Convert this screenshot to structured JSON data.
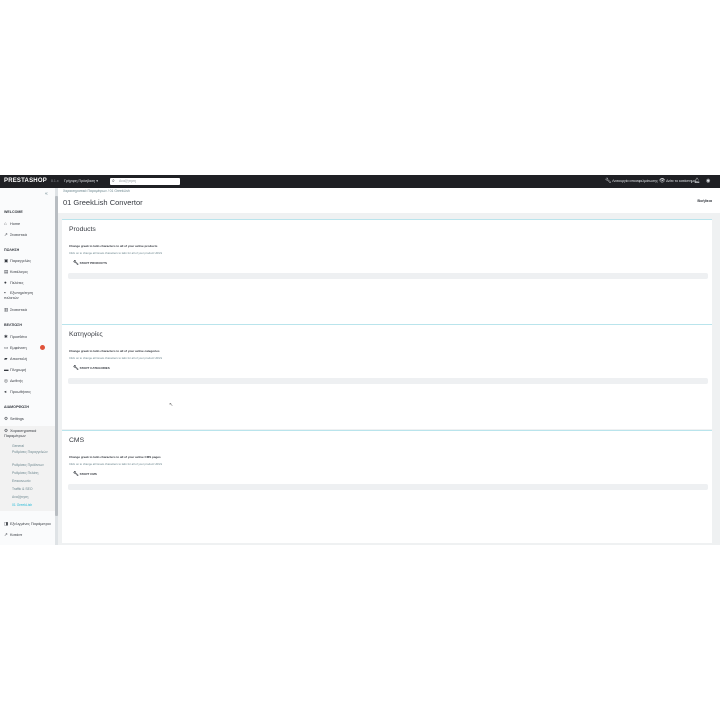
{
  "topbar": {
    "logo": "PRESTASHOP",
    "version": "8.1.x",
    "quick_access": "Γρήγορη Πρόσβαση ▾",
    "search_placeholder": "Αναζήτηση",
    "debug_mode": "Λειτουργία αποσφαλμάτωσης",
    "view_store": "Δείτε το κατάστημα",
    "icons": [
      "wrench-icon",
      "eye-icon",
      "bell-icon",
      "user-icon"
    ]
  },
  "sidebar": {
    "sections": {
      "welcome": "WELCOME",
      "sell": "ΠΩΛΗΣΗ",
      "improve": "ΒΕΛΤΙΩΣΗ",
      "configure": "ΔΙΑΜΟΡΦΩΣΗ"
    },
    "items": {
      "home": "Home",
      "dashboard": "Στατιστικά",
      "orders": "Παραγγελίες",
      "catalog": "Κατάλογος",
      "customers": "Πελάτες",
      "service": "Εξυπηρέτηση πελατών",
      "stats": "Στατιστικά",
      "modules": "Προσθέτα",
      "design": "Εμφάνιση",
      "shipping": "Αποστολή",
      "payment": "Πληρωμή",
      "international": "Διεθνής",
      "promotions": "Προωθήσεις",
      "settings": "Settings",
      "shop_params": "Χαρακτηριστικά Παραμέτρων",
      "advanced": "Εξελιγμένες Παράμετροι",
      "stats2": "Κατάστ"
    },
    "submenu": [
      "General",
      "Ρυθμίσεις Παραγγελιών",
      "Ρυθμίσεις Προϊόντων",
      "Ρυθμίσεις Πελάτη",
      "Επικοινωνία",
      "Traffic & SEO",
      "Αναζήτηση",
      "01 GreekLish"
    ],
    "modules_badge": "1"
  },
  "header": {
    "breadcrumb": "Χαρακτηριστικά Παραμέτρων  /  01 GreekLish",
    "title": "01 GreekLish Convertor",
    "help": "Βοήθεια"
  },
  "panels": [
    {
      "title": "Products",
      "line1": "Change greek to latin characters to all of your active products",
      "line2": "Click on to change all Greek characters to latin for all of your product URLS",
      "button": "START PRODUCTS"
    },
    {
      "title": "Κατηγορίες",
      "line1": "Change greek to latin characters to all of your active categories",
      "line2": "Click on to change all Greek characters to latin for all of your product URLS",
      "button": "START CATEGORIES"
    },
    {
      "title": "CMS",
      "line1": "Change greek to latin characters to all of your active CMS pages",
      "line2": "Click on to change all Greek characters to latin for all of your product URLS",
      "button": "START CMS"
    }
  ]
}
